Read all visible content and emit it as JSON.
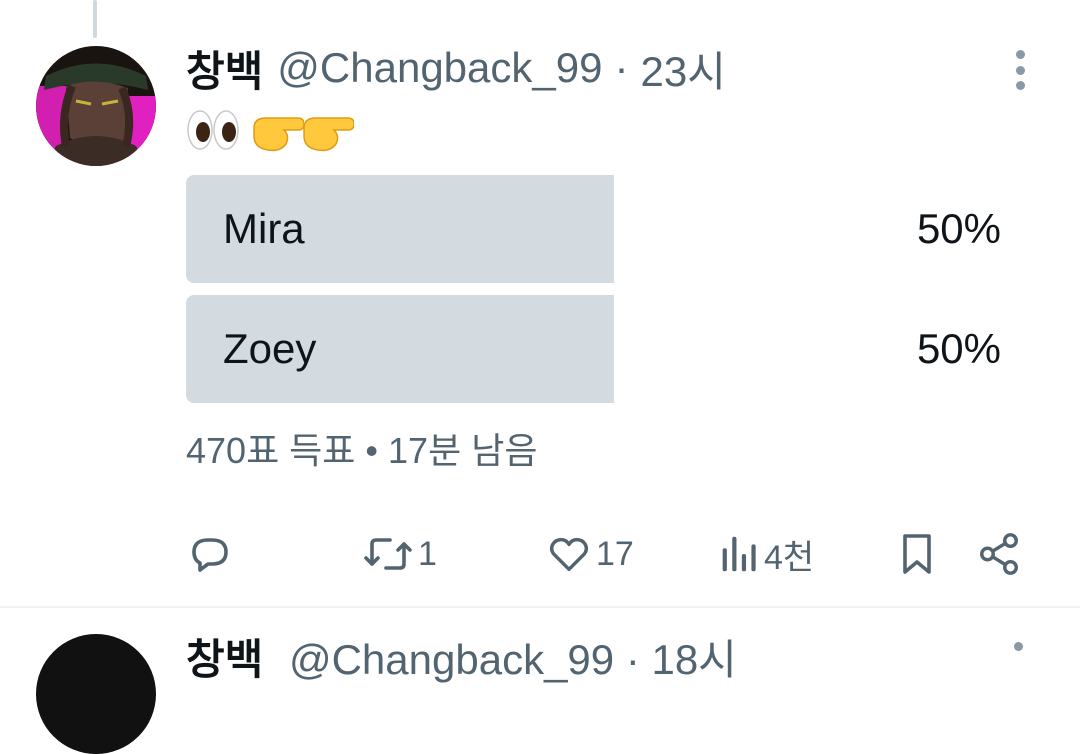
{
  "tweet": {
    "display_name": "창백",
    "handle": "@Changback_99",
    "separator": "·",
    "time": "23시",
    "emojis": [
      "eyes",
      "pointing-right",
      "pointing-left"
    ]
  },
  "poll": {
    "options": [
      {
        "label": "Mira",
        "percent_text": "50%",
        "percent": 50
      },
      {
        "label": "Zoey",
        "percent_text": "50%",
        "percent": 50
      }
    ],
    "meta": "470표 득표 • 17분 남음"
  },
  "actions": {
    "reply_count": "",
    "retweet_count": "1",
    "like_count": "17",
    "views_count": "4천"
  },
  "next_tweet": {
    "display_name": "창백",
    "handle": "@Changback_99 · 18시"
  },
  "colors": {
    "poll_fill": "#d3dbe0",
    "secondary_text": "#536471",
    "primary_text": "#0f1419"
  }
}
